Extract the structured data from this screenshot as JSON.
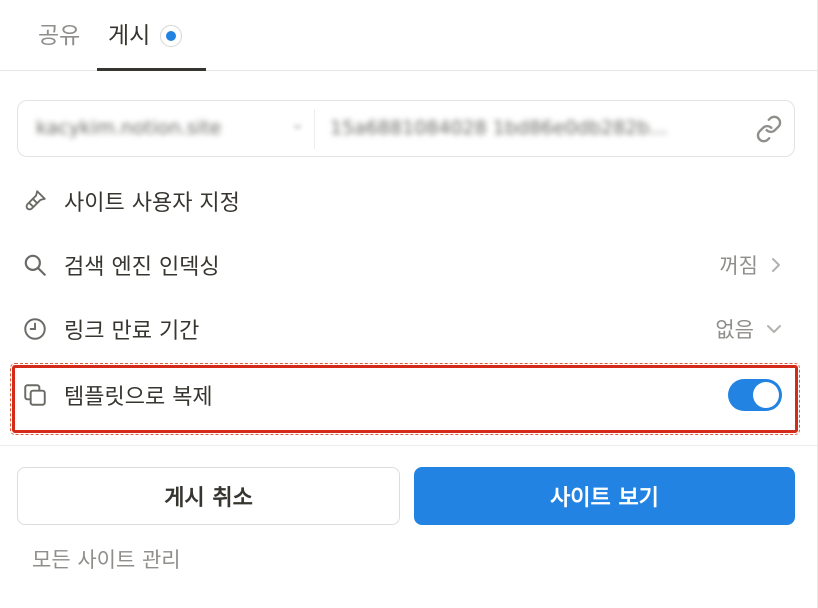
{
  "tabs": [
    {
      "label": "공유"
    },
    {
      "label": "게시"
    }
  ],
  "url": {
    "domain": "kacykim.notion.site",
    "path": "15a6881084028 1bd86e0db282b..."
  },
  "options": {
    "customize": {
      "label": "사이트 사용자 지정"
    },
    "seo": {
      "label": "검색 엔진 인덱싱",
      "value": "꺼짐"
    },
    "expiry": {
      "label": "링크 만료 기간",
      "value": "없음"
    },
    "template": {
      "label": "템플릿으로 복제",
      "enabled": true
    }
  },
  "buttons": {
    "unpublish": "게시 취소",
    "view_site": "사이트 보기"
  },
  "footer": {
    "manage_sites": "모든 사이트 관리"
  },
  "colors": {
    "accent": "#2383e2",
    "highlight": "#d42a1a"
  }
}
